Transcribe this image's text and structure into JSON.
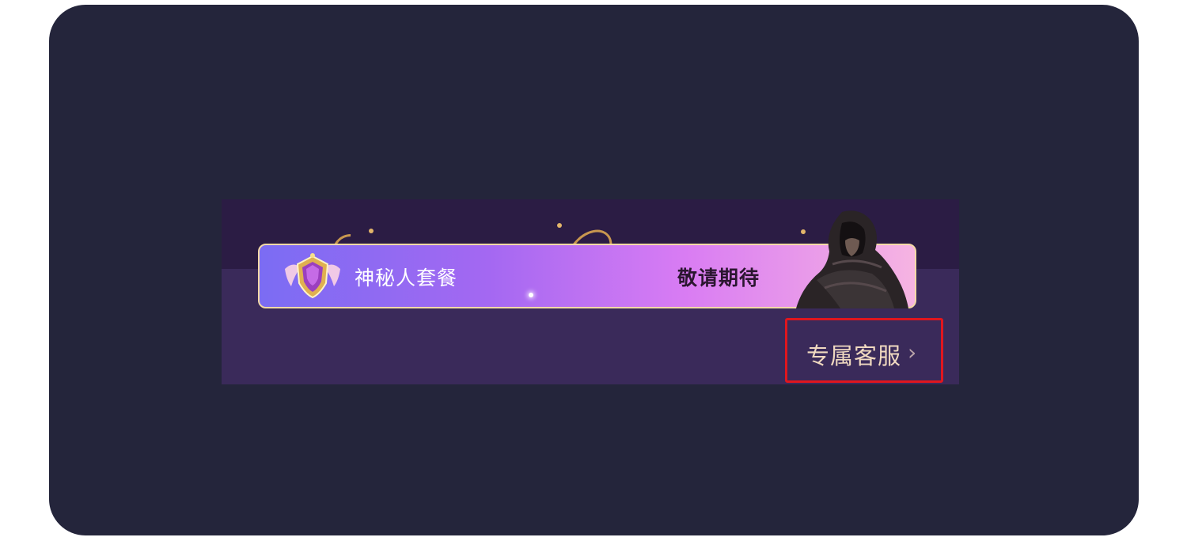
{
  "banner": {
    "package_name": "神秘人套餐",
    "package_status": "敬请期待",
    "service_link_label": "专属客服",
    "chevron_glyph": "›"
  },
  "icons": {
    "badge": "crest-badge-icon",
    "character": "hooded-figure-icon",
    "chevron": "chevron-right-icon"
  },
  "colors": {
    "outer_background": "#24253b",
    "banner_background": "#3a2a5a",
    "gradient_start": "#7b6cf3",
    "gradient_end": "#f6b4e2",
    "highlight_border": "#e0161e",
    "service_text": "#f0d9c0"
  }
}
